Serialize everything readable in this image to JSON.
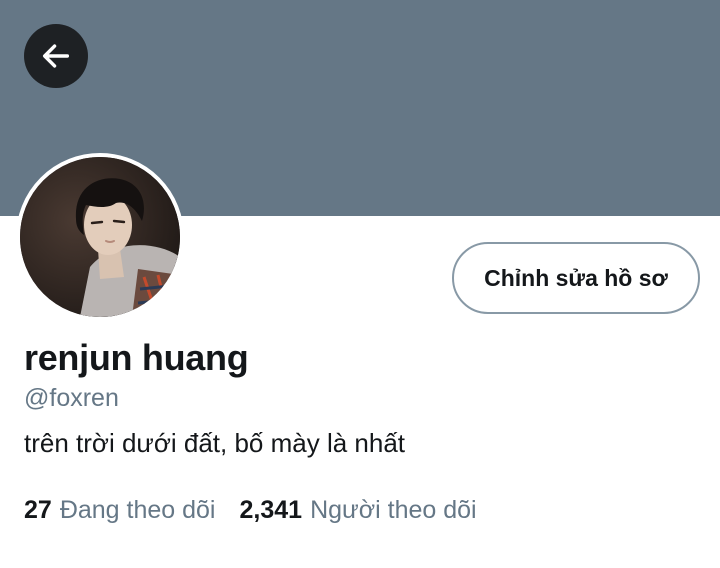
{
  "banner": {
    "color": "#657786"
  },
  "nav": {
    "back_icon": "arrow-left-icon"
  },
  "profile": {
    "avatar_icon": "profile-photo",
    "edit_button_label": "Chỉnh sửa hồ sơ",
    "display_name": "renjun huang",
    "handle": "@foxren",
    "bio": "trên trời dưới đất, bố mày là nhất"
  },
  "stats": {
    "following_count": "27",
    "following_label": "Đang theo dõi",
    "followers_count": "2,341",
    "followers_label": "Người theo dõi"
  },
  "colors": {
    "text_primary": "#14171a",
    "text_secondary": "#657786",
    "button_border": "#8899a6",
    "back_button_bg": "#1e2124"
  }
}
